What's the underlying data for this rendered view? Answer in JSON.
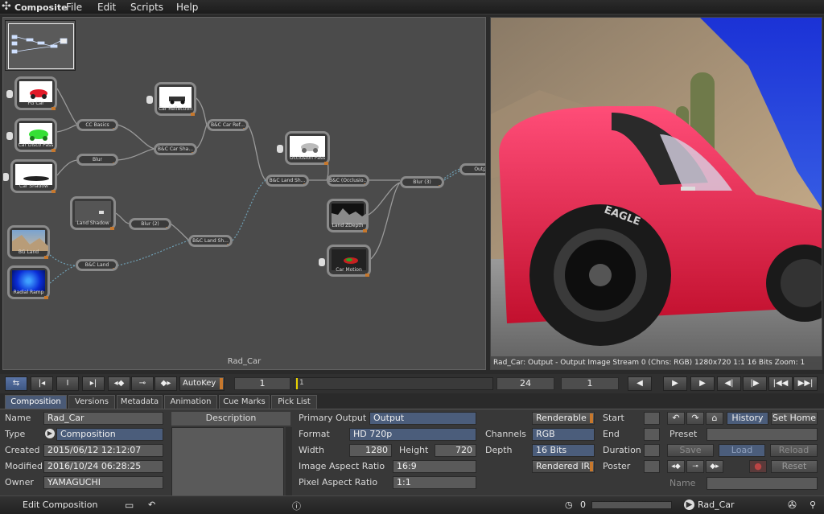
{
  "menubar": {
    "app": "Composite",
    "items": [
      "File",
      "Edit",
      "Scripts",
      "Help"
    ]
  },
  "nodegraph": {
    "name": "Rad_Car",
    "nodes": {
      "fg_car": "FG Car",
      "car_disco": "Car Disco Pass",
      "car_shadow": "Car Shadow",
      "car_reflection": "Car Reflection",
      "cc_basics": "CC Basics",
      "blur": "Blur",
      "bc_car_sha": "B&C Car Sha...",
      "bc_car_ref": "B&C Car Ref...",
      "land_shadow": "Land Shadow",
      "blur2": "Blur (2)",
      "bg_land": "BG Land",
      "radial_ramp": "Radial Ramp",
      "bc_land": "B&C Land",
      "bc_land_sh": "B&C Land Sh...",
      "bc_land_sh2": "B&C Land Sh...",
      "occlusion": "Occlusion Pass",
      "bc_occlusio": "B&C (Occlusio...",
      "blur3": "Blur (3)",
      "outp": "Outp",
      "land_zdepth": "Land ZDepth",
      "car_motion": "Car Motion"
    }
  },
  "viewer": {
    "info": "Rad_Car: Output - Output Image Stream 0 (Chns: RGB)  1280x720  1:1  16 Bits  Zoom: 1"
  },
  "transport": {
    "autokey": "AutoKey",
    "current_frame": "1",
    "ruler_start": "1",
    "end_frame": "24",
    "step": "1"
  },
  "tabs": [
    "Composition",
    "Versions",
    "Metadata",
    "Animation",
    "Cue Marks",
    "Pick List"
  ],
  "composition": {
    "name_label": "Name",
    "name": "Rad_Car",
    "type_label": "Type",
    "type": "Composition",
    "created_label": "Created",
    "created": "2015/06/12 12:12:07",
    "modified_label": "Modified",
    "modified": "2016/10/24 06:28:25",
    "owner_label": "Owner",
    "owner": "YAMAGUCHI",
    "description_label": "Description"
  },
  "output": {
    "primary_output_label": "Primary Output",
    "primary_output": "Output",
    "format_label": "Format",
    "format": "HD 720p",
    "width_label": "Width",
    "width": "1280",
    "height_label": "Height",
    "height": "720",
    "image_aspect_label": "Image Aspect Ratio",
    "image_aspect": "16:9",
    "pixel_aspect_label": "Pixel Aspect Ratio",
    "pixel_aspect": "1:1",
    "channels_label": "Channels",
    "channels": "RGB",
    "depth_label": "Depth",
    "depth": "16 Bits",
    "renderable": "Renderable",
    "rendered_ir": "Rendered IR"
  },
  "timing": {
    "start": "Start",
    "end": "End",
    "duration": "Duration",
    "poster": "Poster"
  },
  "history": {
    "history": "History",
    "set_home": "Set Home",
    "preset": "Preset",
    "save": "Save",
    "load": "Load",
    "reload": "Reload",
    "reset": "Reset",
    "name": "Name"
  },
  "status": {
    "mode": "Edit Composition",
    "counter": "0",
    "comp": "Rad_Car"
  },
  "colors": {
    "accent_blue": "#4b5d7b",
    "orange_tab": "#c7782d",
    "timeline_marker": "#e8d200"
  }
}
